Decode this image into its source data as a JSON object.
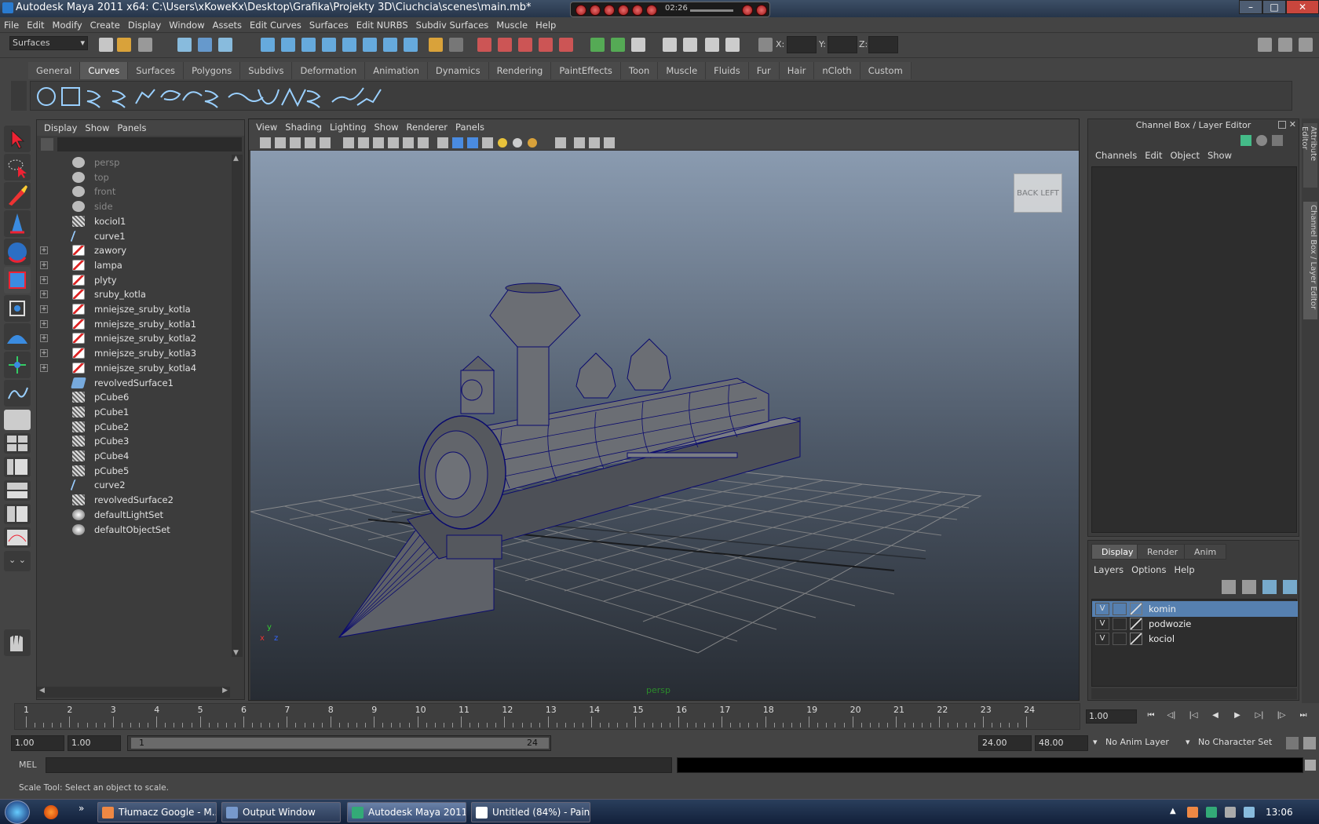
{
  "window": {
    "title": "Autodesk Maya 2011 x64: C:\\Users\\xKoweKx\\Desktop\\Grafika\\Projekty 3D\\Ciuchcia\\scenes\\main.mb*"
  },
  "media_player": {
    "time": "02:26"
  },
  "menubar": [
    "File",
    "Edit",
    "Modify",
    "Create",
    "Display",
    "Window",
    "Assets",
    "Edit Curves",
    "Surfaces",
    "Edit NURBS",
    "Subdiv Surfaces",
    "Muscle",
    "Help"
  ],
  "toolbar": {
    "mode": "Surfaces",
    "x_label": "X:",
    "y_label": "Y:",
    "z_label": "Z:"
  },
  "shelf": {
    "tabs": [
      "General",
      "Curves",
      "Surfaces",
      "Polygons",
      "Subdivs",
      "Deformation",
      "Animation",
      "Dynamics",
      "Rendering",
      "PaintEffects",
      "Toon",
      "Muscle",
      "Fluids",
      "Fur",
      "Hair",
      "nCloth",
      "Custom"
    ],
    "active": "Curves"
  },
  "outliner": {
    "menu": [
      "Display",
      "Show",
      "Panels"
    ],
    "items": [
      {
        "label": "persp",
        "icon": "camera-icon",
        "expandable": false
      },
      {
        "label": "top",
        "icon": "camera-icon",
        "expandable": false
      },
      {
        "label": "front",
        "icon": "camera-icon",
        "expandable": false
      },
      {
        "label": "side",
        "icon": "camera-icon",
        "expandable": false
      },
      {
        "label": "kociol1",
        "icon": "mesh-icon",
        "expandable": false
      },
      {
        "label": "curve1",
        "icon": "curve-icon",
        "expandable": false
      },
      {
        "label": "zawory",
        "icon": "group-icon",
        "expandable": true
      },
      {
        "label": "lampa",
        "icon": "group-icon",
        "expandable": true
      },
      {
        "label": "plyty",
        "icon": "group-icon",
        "expandable": true
      },
      {
        "label": "sruby_kotla",
        "icon": "group-icon",
        "expandable": true
      },
      {
        "label": "mniejsze_sruby_kotla",
        "icon": "group-icon",
        "expandable": true
      },
      {
        "label": "mniejsze_sruby_kotla1",
        "icon": "group-icon",
        "expandable": true
      },
      {
        "label": "mniejsze_sruby_kotla2",
        "icon": "group-icon",
        "expandable": true
      },
      {
        "label": "mniejsze_sruby_kotla3",
        "icon": "group-icon",
        "expandable": true
      },
      {
        "label": "mniejsze_sruby_kotla4",
        "icon": "group-icon",
        "expandable": true
      },
      {
        "label": "revolvedSurface1",
        "icon": "surface-icon",
        "expandable": false
      },
      {
        "label": "pCube6",
        "icon": "mesh-icon",
        "expandable": false
      },
      {
        "label": "pCube1",
        "icon": "mesh-icon",
        "expandable": false
      },
      {
        "label": "pCube2",
        "icon": "mesh-icon",
        "expandable": false
      },
      {
        "label": "pCube3",
        "icon": "mesh-icon",
        "expandable": false
      },
      {
        "label": "pCube4",
        "icon": "mesh-icon",
        "expandable": false
      },
      {
        "label": "pCube5",
        "icon": "mesh-icon",
        "expandable": false
      },
      {
        "label": "curve2",
        "icon": "curve-icon",
        "expandable": false
      },
      {
        "label": "revolvedSurface2",
        "icon": "mesh-icon",
        "expandable": false
      },
      {
        "label": "defaultLightSet",
        "icon": "set-icon",
        "expandable": false
      },
      {
        "label": "defaultObjectSet",
        "icon": "set-icon",
        "expandable": false
      }
    ]
  },
  "viewport": {
    "menu": [
      "View",
      "Shading",
      "Lighting",
      "Show",
      "Renderer",
      "Panels"
    ],
    "camera": "persp",
    "viewcube": {
      "face1": "BACK",
      "face2": "LEFT"
    },
    "axis_y": "y",
    "axis_x": "x",
    "axis_z": "z"
  },
  "channel_box": {
    "title": "Channel Box / Layer Editor",
    "menu": [
      "Channels",
      "Edit",
      "Object",
      "Show"
    ]
  },
  "side_tabs": [
    "Attribute Editor",
    "Channel Box / Layer Editor"
  ],
  "layer_editor": {
    "tabs": [
      "Display",
      "Render",
      "Anim"
    ],
    "active_tab": "Display",
    "menu": [
      "Layers",
      "Options",
      "Help"
    ],
    "layers": [
      {
        "visible": "V",
        "name": "komin",
        "selected": true
      },
      {
        "visible": "V",
        "name": "podwozie",
        "selected": false
      },
      {
        "visible": "V",
        "name": "kociol",
        "selected": false
      }
    ]
  },
  "time_slider": {
    "ticks": [
      "1",
      "2",
      "3",
      "4",
      "5",
      "6",
      "7",
      "8",
      "9",
      "10",
      "11",
      "12",
      "13",
      "14",
      "15",
      "16",
      "17",
      "18",
      "19",
      "20",
      "21",
      "22",
      "23",
      "24"
    ],
    "current_frame": "1.00"
  },
  "range_slider": {
    "start_time": "1.00",
    "playback_start": "1.00",
    "range_start": "1",
    "range_end": "24",
    "playback_end": "24.00",
    "end_time": "48.00",
    "anim_layer": "No Anim Layer",
    "character_set": "No Character Set"
  },
  "command_line": {
    "label": "MEL"
  },
  "help_line": "Scale Tool: Select an object to scale.",
  "taskbar": {
    "tasks": [
      {
        "label": "Tłumacz Google - M...",
        "active": false
      },
      {
        "label": "Output Window",
        "active": false
      },
      {
        "label": "Autodesk Maya 2011...",
        "active": true
      },
      {
        "label": "Untitled (84%) - Pain...",
        "active": false
      }
    ],
    "clock": "13:06"
  },
  "colors": {
    "layer_selected": "#5680b0",
    "wireframe": "#0a0a6e",
    "grid": "#8c8c8c",
    "model": "#6b6e74"
  }
}
